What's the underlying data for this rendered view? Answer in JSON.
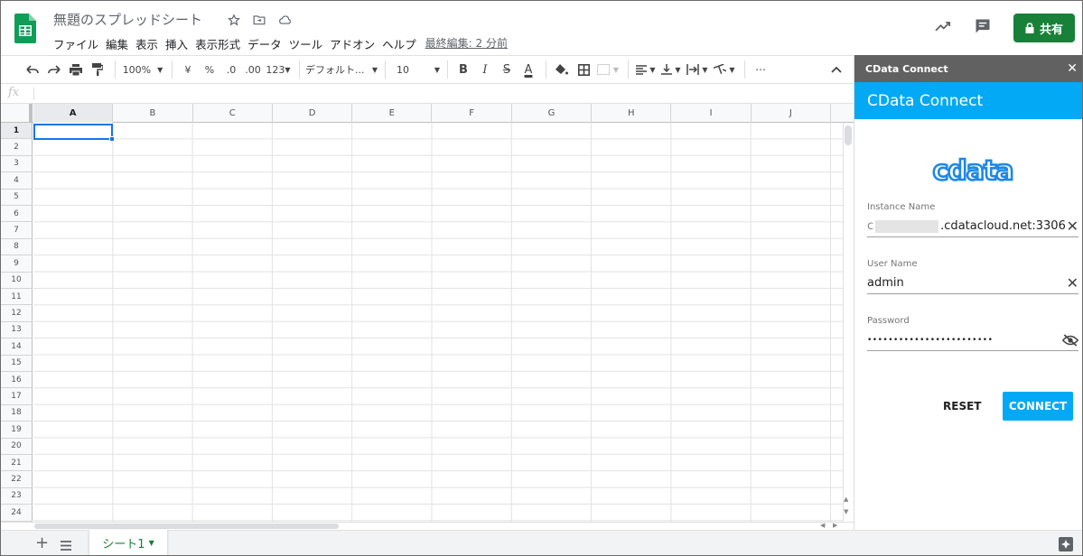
{
  "header": {
    "doc_title": "無題のスプレッドシート",
    "menus": [
      "ファイル",
      "編集",
      "表示",
      "挿入",
      "表示形式",
      "データ",
      "ツール",
      "アドオン",
      "ヘルプ"
    ],
    "last_edit": "最終編集: 2 分前",
    "share_label": "共有"
  },
  "toolbar": {
    "zoom": "100%",
    "currency": "¥",
    "percent": "%",
    "dec_decrease": ".0",
    "dec_increase": ".00",
    "format_more": "123",
    "font": "デフォルト...",
    "font_size": "10",
    "bold": "B",
    "italic": "I",
    "strike": "S",
    "text_color": "A",
    "more": "⋯"
  },
  "formula_bar": {
    "fx": "fx"
  },
  "grid": {
    "columns": [
      "A",
      "B",
      "C",
      "D",
      "E",
      "F",
      "G",
      "H",
      "I",
      "J"
    ],
    "rows": [
      "1",
      "2",
      "3",
      "4",
      "5",
      "6",
      "7",
      "8",
      "9",
      "10",
      "11",
      "12",
      "13",
      "14",
      "15",
      "16",
      "17",
      "18",
      "19",
      "20",
      "21",
      "22",
      "23",
      "24"
    ],
    "selected_cell": "A1"
  },
  "sheets": {
    "tabs": [
      "シート1"
    ]
  },
  "panel": {
    "top_title": "CData Connect",
    "head_title": "CData Connect",
    "logo_text": "cdata",
    "instance_label": "Instance Name",
    "instance_value_prefix": "c",
    "instance_value": ".cdatacloud.net:3306",
    "user_label": "User Name",
    "user_value": "admin",
    "password_label": "Password",
    "password_value": "••••••••••••••••••••••••",
    "reset_label": "RESET",
    "connect_label": "CONNECT"
  },
  "colors": {
    "sheets_green": "#188038",
    "panel_blue": "#03a9f4",
    "selection_blue": "#1a73e8"
  }
}
